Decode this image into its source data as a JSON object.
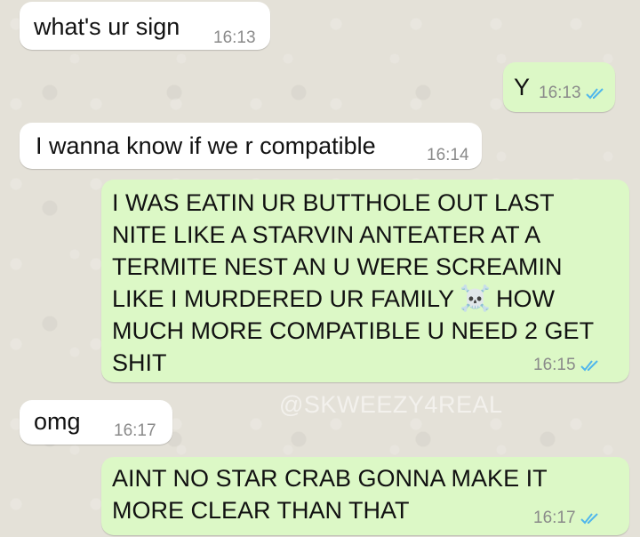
{
  "messages": [
    {
      "direction": "incoming",
      "text": "what's ur sign",
      "time": "16:13"
    },
    {
      "direction": "outgoing",
      "text": "Y",
      "time": "16:13",
      "status": "read"
    },
    {
      "direction": "incoming",
      "text": "I wanna know if we r compatible",
      "time": "16:14"
    },
    {
      "direction": "outgoing",
      "lines": [
        "I WAS EATIN UR BUTTHOLE OUT LAST",
        "NITE LIKE A STARVIN ANTEATER AT A",
        "TERMITE NEST AN U WERE SCREAMIN",
        "LIKE I MURDERED UR FAMILY",
        "HOW",
        "MUCH MORE COMPATIBLE U NEED 2 GET",
        "SHIT"
      ],
      "emoji": "☠️",
      "time": "16:15",
      "status": "read"
    },
    {
      "direction": "incoming",
      "text": "omg",
      "time": "16:17"
    },
    {
      "direction": "outgoing",
      "lines": [
        "AINT NO STAR CRAB GONNA MAKE IT",
        "MORE CLEAR THAN THAT"
      ],
      "time": "16:17",
      "status": "read"
    }
  ],
  "watermark": "@SKWEEZY4REAL",
  "colors": {
    "incoming": "#ffffff",
    "outgoing": "#dcf8c6",
    "read_ticks": "#4fb6ec",
    "background": "#e4e1d8"
  },
  "icons": {
    "read_status": "double-check-icon",
    "emoji": "skull-and-crossbones"
  }
}
